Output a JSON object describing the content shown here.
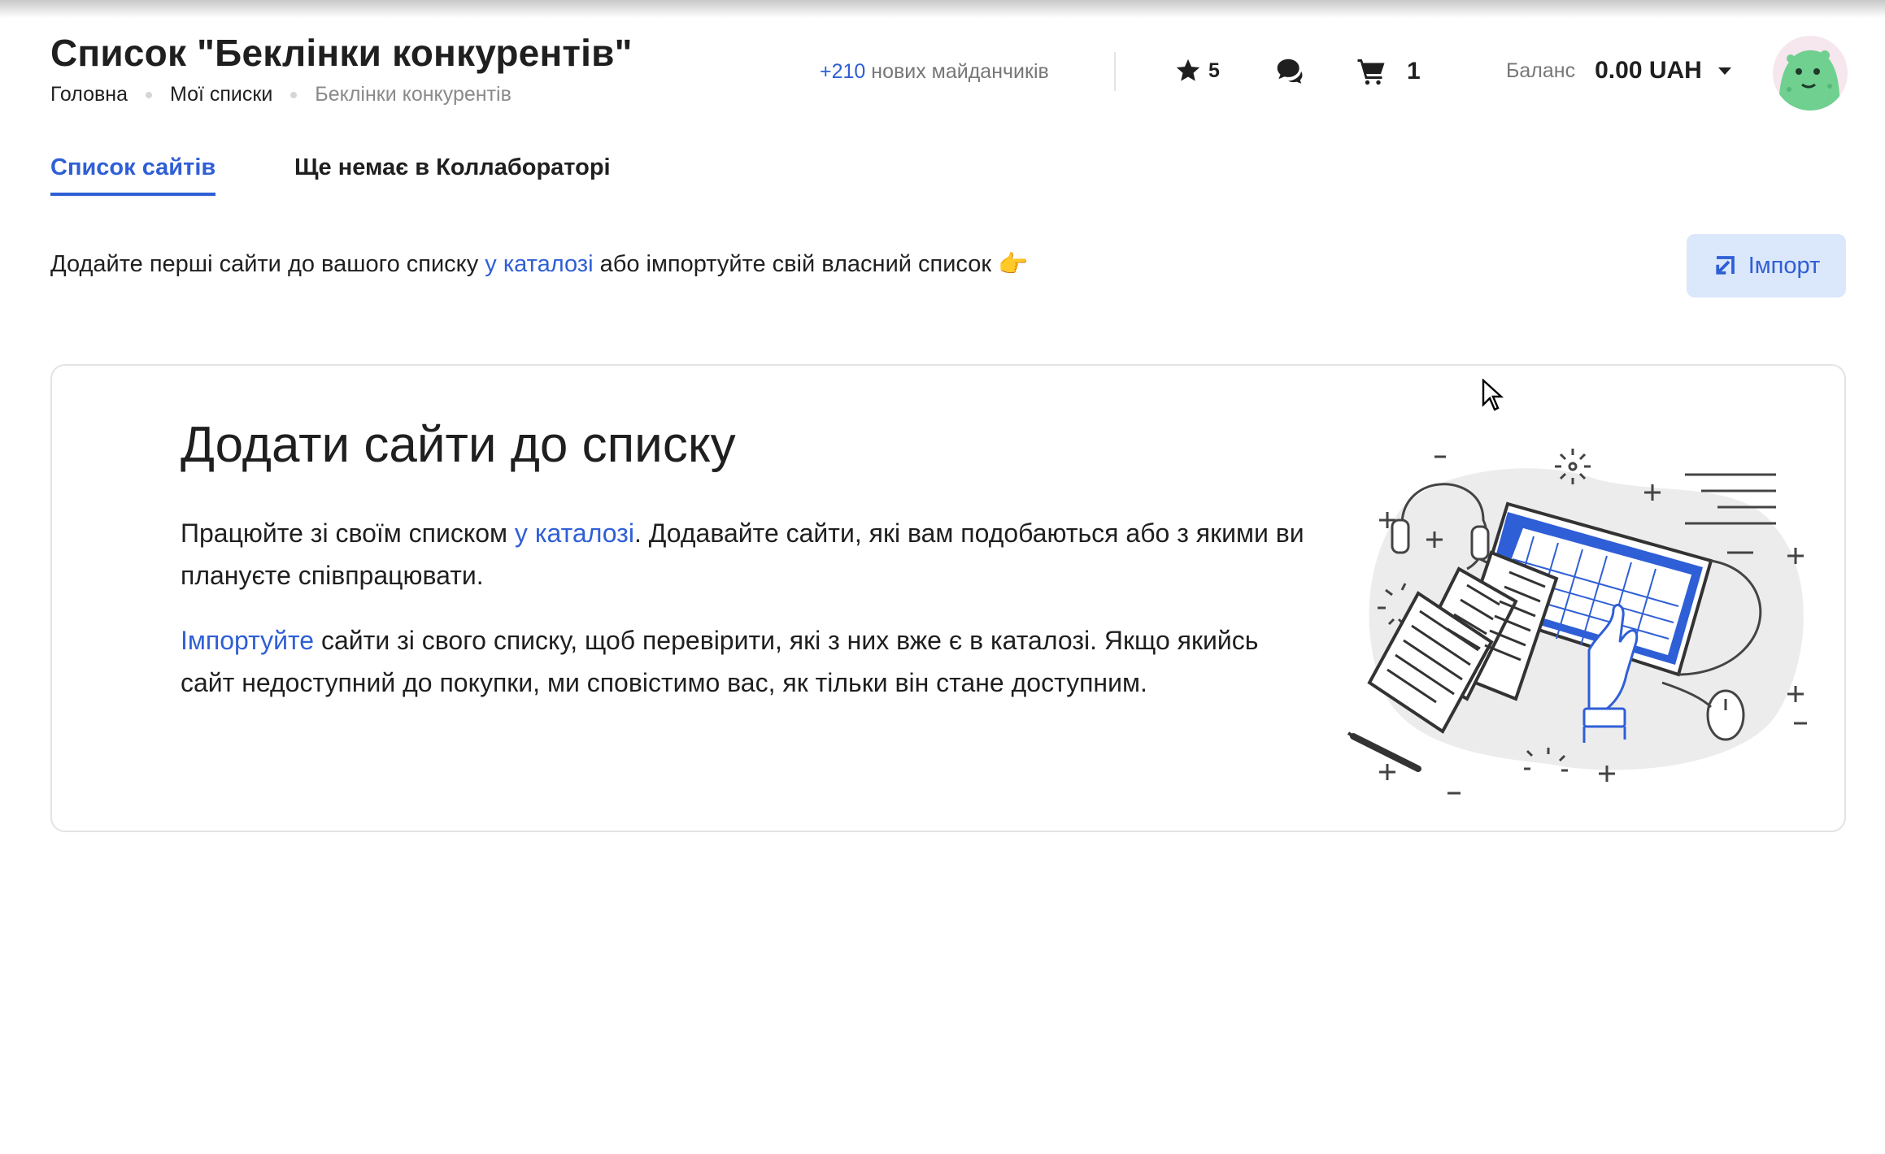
{
  "header": {
    "title": "Список \"Беклінки конкурентів\"",
    "breadcrumb": [
      "Головна",
      "Мої списки",
      "Беклінки конкурентів"
    ],
    "new_sites_count": "+210",
    "new_sites_text": "нових майданчиків",
    "favorites_count": "5",
    "cart_count": "1",
    "balance_label": "Баланс",
    "balance_value": "0.00 UAH"
  },
  "tabs": [
    {
      "label": "Список сайтів",
      "active": true
    },
    {
      "label": "Ще немає в Коллабораторі",
      "active": false
    }
  ],
  "info": {
    "before": "Додайте перші сайти до вашого списку",
    "link": "у каталозі",
    "after": "або імпортуйте свій власний список",
    "emoji": "👉"
  },
  "import_button": "Імпорт",
  "card": {
    "title": "Додати сайти до списку",
    "p1_before": "Працюйте зі своїм списком",
    "p1_link": "у каталозі",
    "p1_after": ". Додавайте сайти, які вам подобаються або з якими ви плануєте співпрацювати.",
    "p2_link": "Імпортуйте",
    "p2_after": "сайти зі свого списку, щоб перевірити, які з них вже є в каталозі. Якщо якийсь сайт недоступний до покупки, ми сповістимо вас, як тільки він стане доступним."
  },
  "colors": {
    "accent": "#2f5fd6",
    "accent_bg": "#dbe7fb",
    "text": "#1f1f1f",
    "muted": "#777777",
    "border": "#e3e3e3"
  },
  "icons": [
    "star-icon",
    "chat-icon",
    "cart-icon",
    "caret-down-icon",
    "import-icon",
    "monster-avatar",
    "cursor-icon"
  ]
}
